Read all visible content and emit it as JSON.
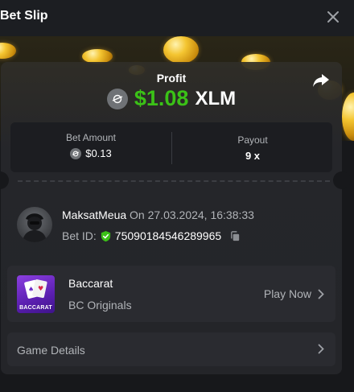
{
  "header": {
    "title": "Bet Slip",
    "close_icon": "close-icon"
  },
  "summary": {
    "profit_label": "Profit",
    "profit_amount": "$1.08",
    "currency": "XLM",
    "share_icon": "share-icon",
    "profit_color": "#3bc117"
  },
  "stats": {
    "bet_amount_label": "Bet Amount",
    "bet_amount_value": "$0.13",
    "payout_label": "Payout",
    "payout_value": "9 x"
  },
  "bet": {
    "username": "MaksatMeua",
    "on_text": "On 27.03.2024, 16:38:33",
    "bet_id_label": "Bet ID:",
    "bet_id": "75090184546289965"
  },
  "game": {
    "name": "Baccarat",
    "provider": "BC Originals",
    "thumb_label": "BACCARAT",
    "play_label": "Play Now"
  },
  "details": {
    "label": "Game Details"
  }
}
